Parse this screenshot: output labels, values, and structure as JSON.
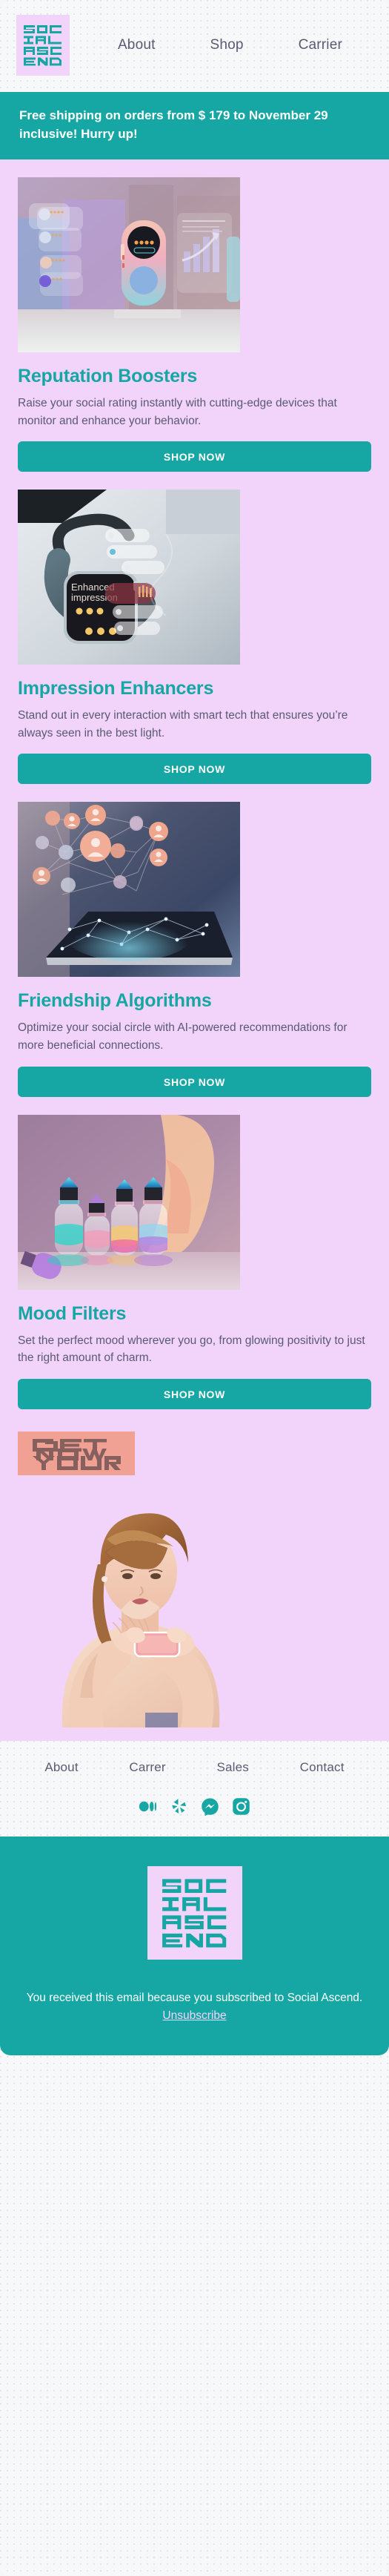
{
  "brand": {
    "name": "Social Ascend",
    "logo_lines": [
      "SOC",
      "IAL",
      "ASC",
      "END"
    ],
    "accent_teal": "#16a7a5",
    "accent_lilac": "#f2d4fa",
    "accent_coral": "#f0a193",
    "text_muted": "#5a5a72"
  },
  "header": {
    "logo_alt": "Social Ascend logo",
    "nav": [
      {
        "label": "About"
      },
      {
        "label": "Shop"
      },
      {
        "label": "Carrier"
      }
    ]
  },
  "promo": {
    "text": "Free shipping on orders from $ 179 to November 29 inclusive! Hurry up!"
  },
  "products": [
    {
      "image_name": "reputation-booster-device-photo",
      "title": "Reputation Boosters",
      "description": "Raise your social rating instantly with cutting-edge devices that monitor and enhance your behavior.",
      "cta": "SHOP NOW"
    },
    {
      "image_name": "smartwatch-enhanced-impression-photo",
      "title": "Impression Enhancers",
      "description": "Stand out in every interaction with smart tech that ensures you’re always seen in the best light.",
      "cta": "SHOP NOW"
    },
    {
      "image_name": "tablet-social-network-graph-photo",
      "title": "Friendship Algorithms",
      "description": "Optimize your social circle with AI-powered recommendations for more beneficial connections.",
      "cta": "SHOP NOW"
    },
    {
      "image_name": "iridescent-mood-filter-bottles-photo",
      "title": "Mood Filters",
      "description": "Set the perfect mood wherever you go, from glowing positivity to just the right amount of charm.",
      "cta": "SHOP NOW"
    }
  ],
  "cta_banner": {
    "lines": [
      "GET",
      "YOURS",
      "NOW"
    ]
  },
  "hero_photo": {
    "image_name": "woman-holding-pink-phone-photo"
  },
  "footer": {
    "nav": [
      {
        "label": "About"
      },
      {
        "label": "Carrer"
      },
      {
        "label": "Sales"
      },
      {
        "label": "Contact"
      }
    ],
    "social": [
      {
        "name": "medium-icon"
      },
      {
        "name": "yelp-icon"
      },
      {
        "name": "facebook-messenger-icon"
      },
      {
        "name": "instagram-icon"
      }
    ],
    "legal_text": "You received this email because you subscribed to Social Ascend.",
    "unsubscribe_label": "Unsubscribe"
  }
}
